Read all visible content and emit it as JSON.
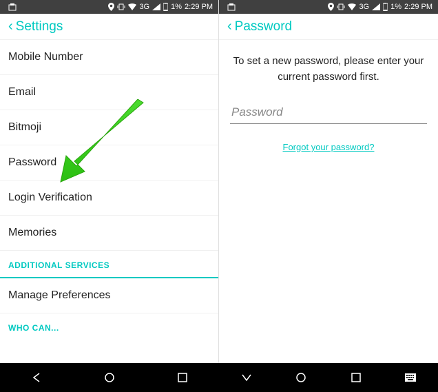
{
  "status": {
    "network": "3G",
    "battery": "1%",
    "time": "2:29 PM"
  },
  "left": {
    "header_title": "Settings",
    "items": [
      "Mobile Number",
      "Email",
      "Bitmoji",
      "Password",
      "Login Verification",
      "Memories"
    ],
    "section1": "ADDITIONAL SERVICES",
    "section1_item": "Manage Preferences",
    "section2": "WHO CAN..."
  },
  "right": {
    "header_title": "Password",
    "instruction": "To set a new password, please enter your current password first.",
    "placeholder": "Password",
    "forgot": "Forgot your password?"
  }
}
